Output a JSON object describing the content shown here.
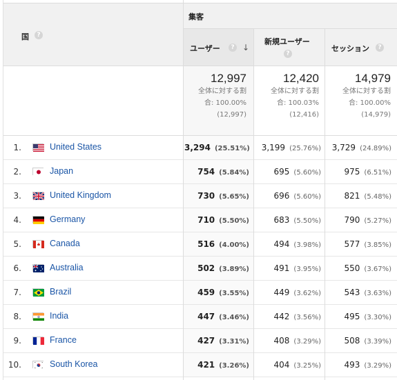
{
  "header": {
    "country_label": "国",
    "group_label": "集客",
    "metrics": [
      {
        "label": "ユーザー",
        "sorted": true
      },
      {
        "label": "新規ユーザー",
        "sorted": false
      },
      {
        "label": "セッション",
        "sorted": false
      }
    ],
    "help_glyph": "?",
    "sort_glyph": "↓"
  },
  "totals": [
    {
      "value": "12,997",
      "line1": "全体に対する割",
      "line2": "合: 100.00%",
      "line3": "(12,997)"
    },
    {
      "value": "12,420",
      "line1": "全体に対する割",
      "line2": "合: 100.03%",
      "line3": "(12,416)"
    },
    {
      "value": "14,979",
      "line1": "全体に対する割",
      "line2": "合: 100.00%",
      "line3": "(14,979)"
    }
  ],
  "rows": [
    {
      "index": "1.",
      "country": "United States",
      "flag": "us-flag-icon",
      "users": "3,294",
      "users_pct": "(25.51%)",
      "new_users": "3,199",
      "new_users_pct": "(25.76%)",
      "sessions": "3,729",
      "sessions_pct": "(24.89%)"
    },
    {
      "index": "2.",
      "country": "Japan",
      "flag": "jp-flag-icon",
      "users": "754",
      "users_pct": "(5.84%)",
      "new_users": "695",
      "new_users_pct": "(5.60%)",
      "sessions": "975",
      "sessions_pct": "(6.51%)"
    },
    {
      "index": "3.",
      "country": "United Kingdom",
      "flag": "gb-flag-icon",
      "users": "730",
      "users_pct": "(5.65%)",
      "new_users": "696",
      "new_users_pct": "(5.60%)",
      "sessions": "821",
      "sessions_pct": "(5.48%)"
    },
    {
      "index": "4.",
      "country": "Germany",
      "flag": "de-flag-icon",
      "users": "710",
      "users_pct": "(5.50%)",
      "new_users": "683",
      "new_users_pct": "(5.50%)",
      "sessions": "790",
      "sessions_pct": "(5.27%)"
    },
    {
      "index": "5.",
      "country": "Canada",
      "flag": "ca-flag-icon",
      "users": "516",
      "users_pct": "(4.00%)",
      "new_users": "494",
      "new_users_pct": "(3.98%)",
      "sessions": "577",
      "sessions_pct": "(3.85%)"
    },
    {
      "index": "6.",
      "country": "Australia",
      "flag": "au-flag-icon",
      "users": "502",
      "users_pct": "(3.89%)",
      "new_users": "491",
      "new_users_pct": "(3.95%)",
      "sessions": "550",
      "sessions_pct": "(3.67%)"
    },
    {
      "index": "7.",
      "country": "Brazil",
      "flag": "br-flag-icon",
      "users": "459",
      "users_pct": "(3.55%)",
      "new_users": "449",
      "new_users_pct": "(3.62%)",
      "sessions": "543",
      "sessions_pct": "(3.63%)"
    },
    {
      "index": "8.",
      "country": "India",
      "flag": "in-flag-icon",
      "users": "447",
      "users_pct": "(3.46%)",
      "new_users": "442",
      "new_users_pct": "(3.56%)",
      "sessions": "495",
      "sessions_pct": "(3.30%)"
    },
    {
      "index": "9.",
      "country": "France",
      "flag": "fr-flag-icon",
      "users": "427",
      "users_pct": "(3.31%)",
      "new_users": "408",
      "new_users_pct": "(3.29%)",
      "sessions": "508",
      "sessions_pct": "(3.39%)"
    },
    {
      "index": "10.",
      "country": "South Korea",
      "flag": "kr-flag-icon",
      "users": "421",
      "users_pct": "(3.26%)",
      "new_users": "404",
      "new_users_pct": "(3.25%)",
      "sessions": "493",
      "sessions_pct": "(3.29%)"
    }
  ]
}
